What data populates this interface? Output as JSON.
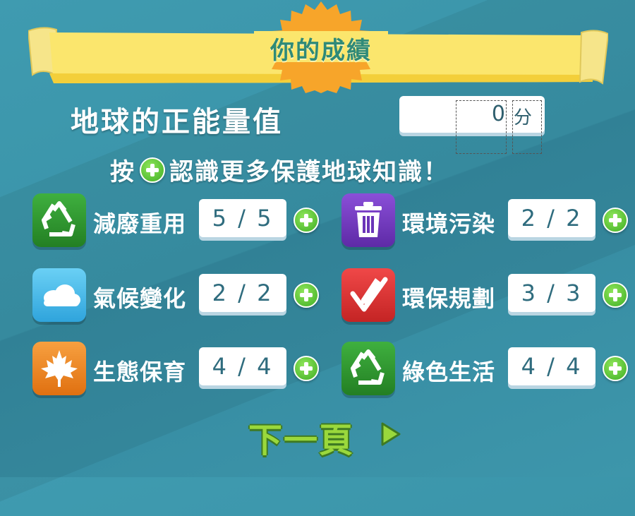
{
  "title": "你的成績",
  "score": {
    "label": "地球的正能量值",
    "value": "0",
    "unit": "分"
  },
  "hint": {
    "before": "按",
    "after": "認識更多保護地球知識！"
  },
  "categories": [
    {
      "label": "減廢重用",
      "count": "5 / 5",
      "icon": "recycle-icon",
      "color": "#2f9a2f"
    },
    {
      "label": "環境污染",
      "count": "2 / 2",
      "icon": "trash-can-icon",
      "color": "#7a3fc8"
    },
    {
      "label": "氣候變化",
      "count": "2 / 2",
      "icon": "cloud-icon",
      "color": "#33b5e5"
    },
    {
      "label": "環保規劃",
      "count": "3 / 3",
      "icon": "pencil-check-icon",
      "color": "#e03a3a"
    },
    {
      "label": "生態保育",
      "count": "4 / 4",
      "icon": "maple-leaf-icon",
      "color": "#f08a2a"
    },
    {
      "label": "綠色生活",
      "count": "4 / 4",
      "icon": "recycle-icon",
      "color": "#2f9a2f"
    }
  ],
  "next_button": {
    "label": "下一頁"
  }
}
